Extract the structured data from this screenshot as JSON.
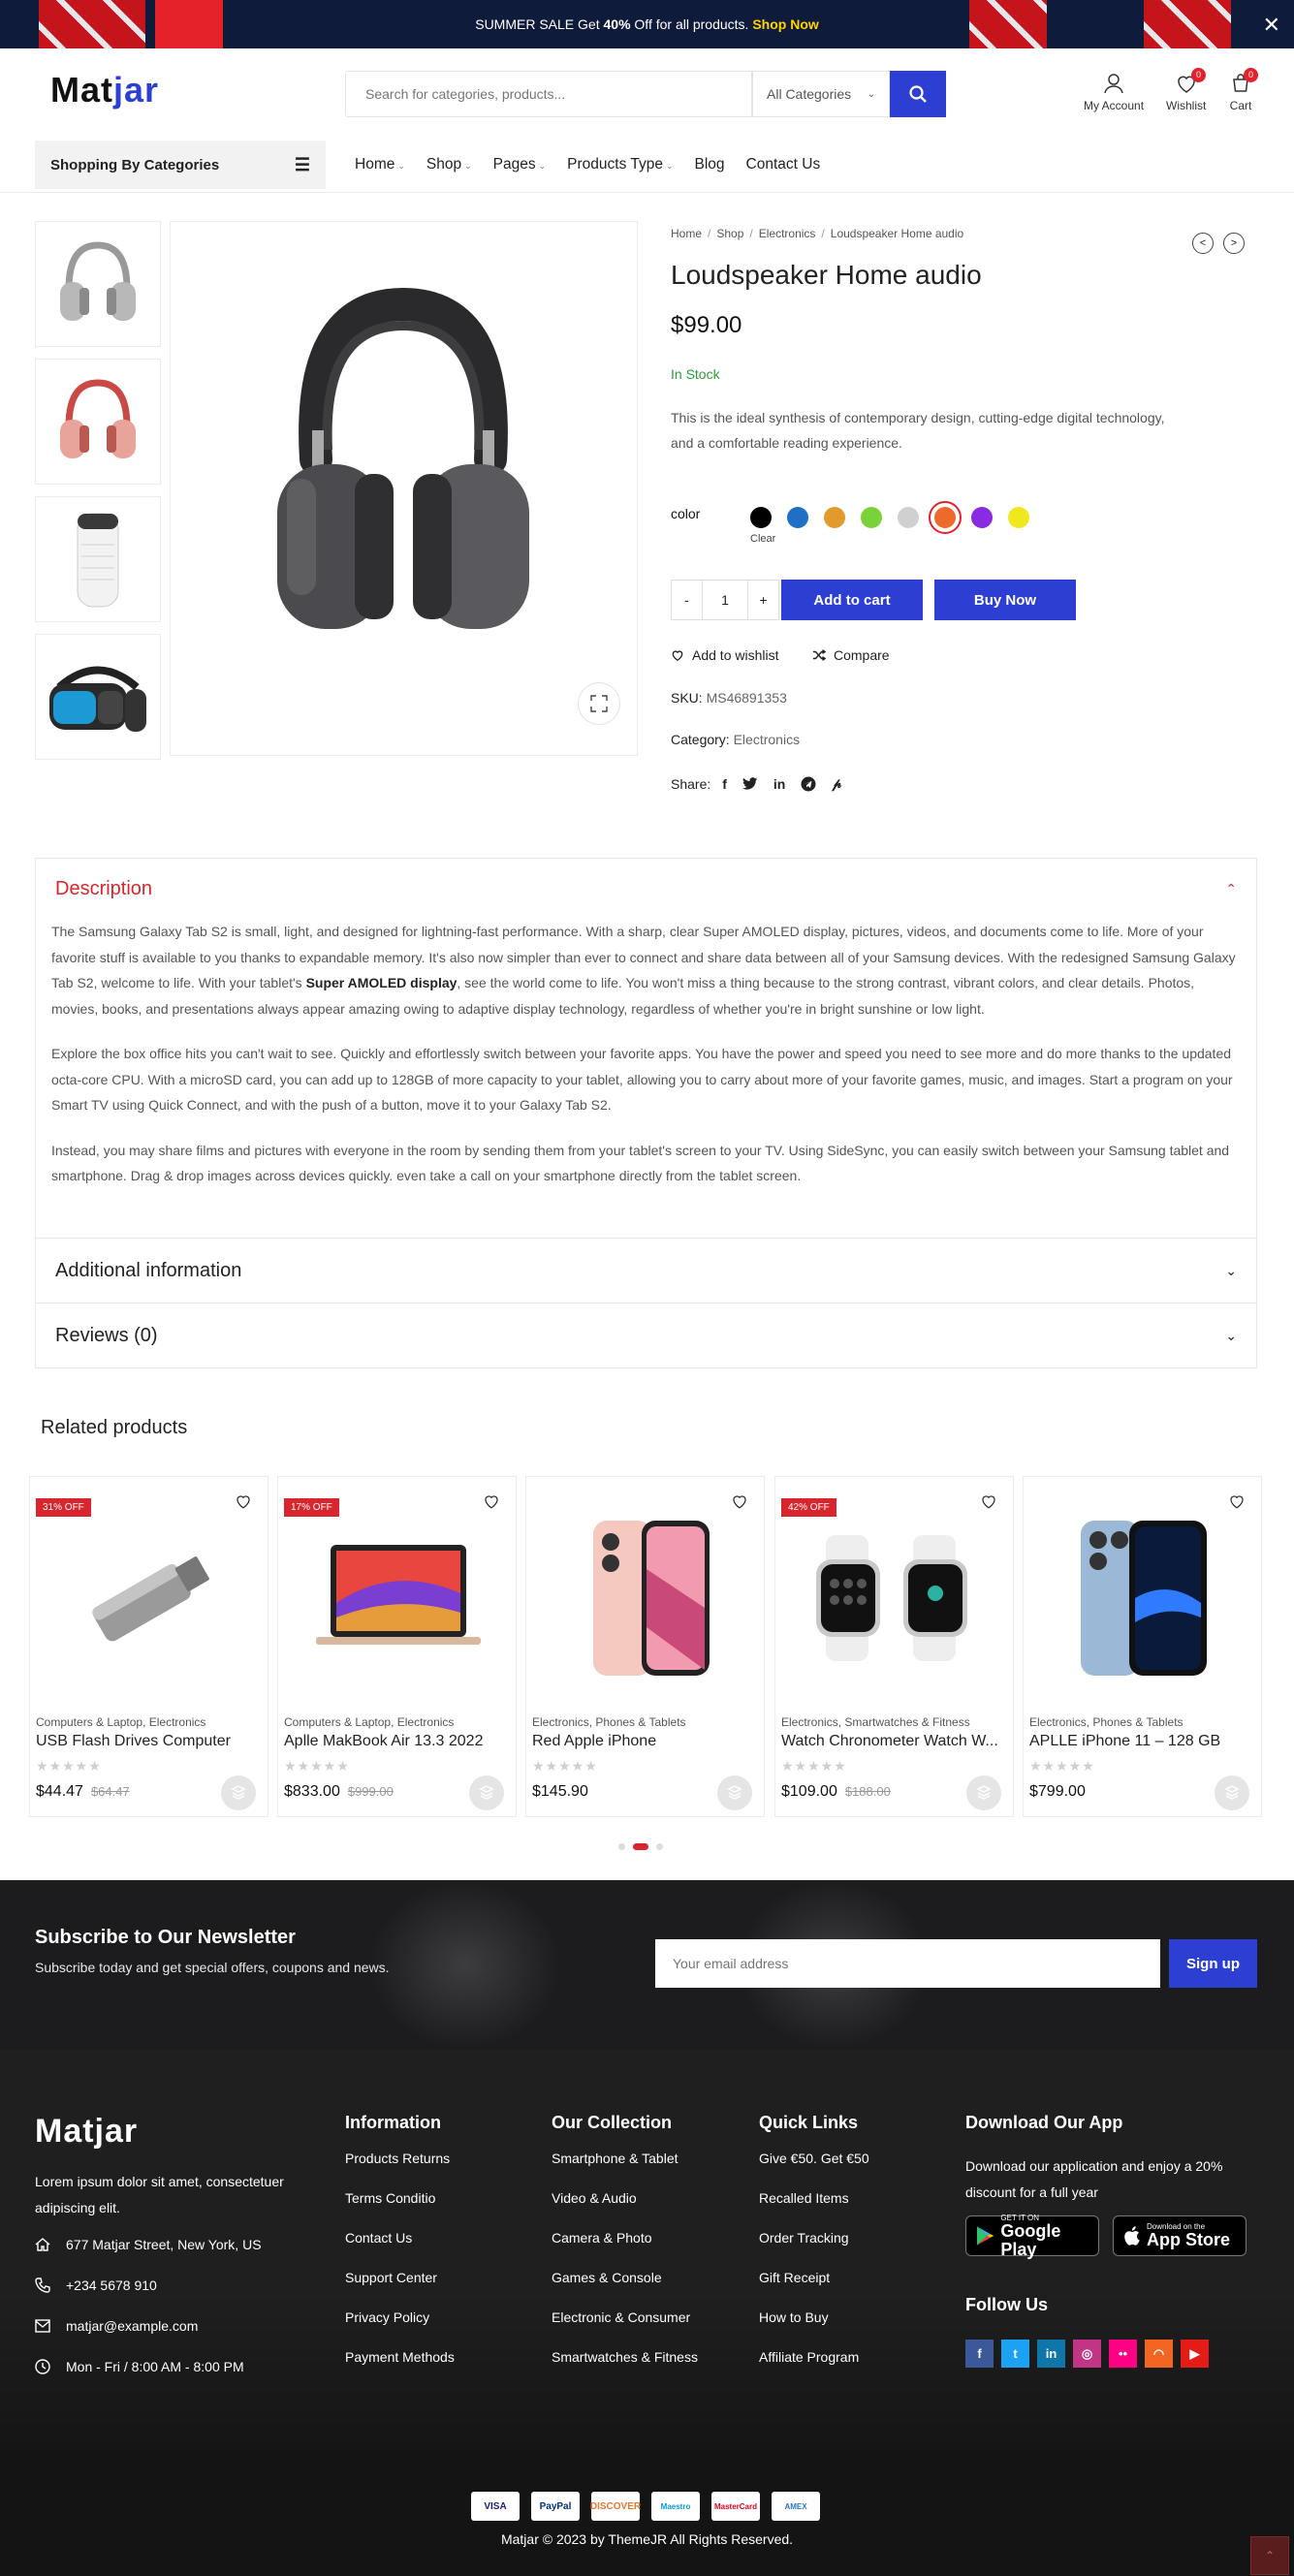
{
  "banner": {
    "text_before": "SUMMER SALE Get ",
    "percent": "40%",
    "text_after": " Off for all products. ",
    "cta": "Shop Now",
    "close": "✕"
  },
  "header": {
    "logo_main": "Mat",
    "logo_accent": "jar",
    "search_placeholder": "Search for categories, products...",
    "category_select": "All Categories",
    "account_label": "My Account",
    "wishlist_label": "Wishlist",
    "wishlist_count": "0",
    "cart_label": "Cart",
    "cart_count": "0"
  },
  "nav": {
    "categories_button": "Shopping By Categories",
    "items": [
      "Home",
      "Shop",
      "Pages",
      "Products Type",
      "Blog",
      "Contact Us"
    ]
  },
  "breadcrumb": [
    "Home",
    "Shop",
    "Electronics",
    "Loudspeaker Home audio"
  ],
  "product": {
    "title": "Loudspeaker Home audio",
    "price": "$99.00",
    "stock": "In Stock",
    "short_desc": "This is the ideal synthesis of contemporary design, cutting-edge digital technology, and a comfortable reading experience.",
    "color_label": "color",
    "clear_label": "Clear",
    "colors": [
      "#000000",
      "#1e6fc5",
      "#e39a2d",
      "#7ad23a",
      "#d0d0d0",
      "#ee6a2a",
      "#8a2be2",
      "#f0e81e"
    ],
    "selected_color": "#ee6a2a",
    "qty_minus": "-",
    "qty": "1",
    "qty_plus": "+",
    "add_to_cart": "Add to cart",
    "buy_now": "Buy Now",
    "wishlist": "Add to wishlist",
    "compare": "Compare",
    "sku_label": "SKU:",
    "sku": "MS46891353",
    "category_label": "Category:",
    "category": "Electronics",
    "share_label": "Share:"
  },
  "tabs": {
    "description_title": "Description",
    "description_paragraphs": [
      "The Samsung Galaxy Tab S2 is small, light, and designed for lightning-fast performance. With a sharp, clear Super AMOLED display, pictures, videos, and documents come to life. More of your favorite stuff is available to you thanks to expandable memory. It's also now simpler than ever to connect and share data between all of your Samsung devices. With the redesigned Samsung Galaxy Tab S2, welcome to life. With your tablet's ",
      "Super AMOLED display",
      ", see the world come to life. You won't miss a thing because to the strong contrast, vibrant colors, and clear details. Photos, movies, books, and presentations always appear amazing owing to adaptive display technology, regardless of whether you're in bright sunshine or low light.",
      "Explore the box office hits you can't wait to see. Quickly and effortlessly switch between your favorite apps. You have the power and speed you need to see more and do more thanks to the updated octa-core CPU. With a microSD card, you can add up to 128GB of more capacity to your tablet, allowing you to carry about more of your favorite games, music, and images. Start a program on your Smart TV using Quick Connect, and with the push of a button, move it to your Galaxy Tab S2.",
      "Instead, you may share films and pictures with everyone in the room by sending them from your tablet's screen to your TV. Using SideSync, you can easily switch between your Samsung tablet and smartphone. Drag & drop images across devices quickly. even take a call on your smartphone directly from the tablet screen."
    ],
    "additional_title": "Additional information",
    "reviews_title": "Reviews (0)"
  },
  "related": {
    "title": "Related products",
    "items": [
      {
        "badge": "31% OFF",
        "category": "Computers & Laptop, Electronics",
        "name": "USB Flash Drives Computer",
        "price": "$44.47",
        "old_price": "$64.47"
      },
      {
        "badge": "17% OFF",
        "category": "Computers & Laptop, Electronics",
        "name": "Aplle MakBook Air 13.3 2022",
        "price": "$833.00",
        "old_price": "$999.00"
      },
      {
        "badge": "",
        "category": "Electronics, Phones & Tablets",
        "name": "Red Apple iPhone",
        "price": "$145.90",
        "old_price": ""
      },
      {
        "badge": "42% OFF",
        "category": "Electronics, Smartwatches & Fitness",
        "name": "Watch Chronometer Watch W...",
        "price": "$109.00",
        "old_price": "$188.00"
      },
      {
        "badge": "",
        "category": "Electronics, Phones & Tablets",
        "name": "APLLE iPhone 11 – 128 GB",
        "price": "$799.00",
        "old_price": ""
      }
    ],
    "stars": "★★★★★"
  },
  "newsletter": {
    "title": "Subscribe to Our Newsletter",
    "subtitle": "Subscribe today and get special offers, coupons and news.",
    "placeholder": "Your email address",
    "button": "Sign up"
  },
  "footer": {
    "logo": "Matjar",
    "about": "Lorem ipsum dolor sit amet, consectetuer adipiscing elit.",
    "address": "677 Matjar Street, New York, US",
    "phone": "+234 5678 910",
    "email": "matjar@example.com",
    "hours": "Mon - Fri / 8:00 AM - 8:00 PM",
    "columns": [
      {
        "title": "Information",
        "links": [
          "Products Returns",
          "Terms Conditio",
          "Contact Us",
          "Support Center",
          "Privacy Policy",
          "Payment Methods"
        ]
      },
      {
        "title": "Our Collection",
        "links": [
          "Smartphone & Tablet",
          "Video & Audio",
          "Camera & Photo",
          "Games & Console",
          "Electronic & Consumer",
          "Smartwatches & Fitness"
        ]
      },
      {
        "title": "Quick Links",
        "links": [
          "Give €50. Get €50",
          "Recalled Items",
          "Order Tracking",
          "Gift Receipt",
          "How to Buy",
          "Affiliate Program"
        ]
      }
    ],
    "app_title": "Download Our App",
    "app_text": "Download our application and enjoy a 20% discount for a full year",
    "google_small": "GET IT ON",
    "google_big": "Google Play",
    "apple_small": "Download on the",
    "apple_big": "App Store",
    "follow_title": "Follow Us",
    "social": [
      {
        "icon": "facebook-icon",
        "glyph": "f",
        "color": "#3b5998"
      },
      {
        "icon": "twitter-icon",
        "glyph": "t",
        "color": "#1da1f2"
      },
      {
        "icon": "linkedin-icon",
        "glyph": "in",
        "color": "#0e76a8"
      },
      {
        "icon": "instagram-icon",
        "glyph": "◎",
        "color": "#c13584"
      },
      {
        "icon": "flickr-icon",
        "glyph": "••",
        "color": "#ff0084"
      },
      {
        "icon": "rss-icon",
        "glyph": "◠",
        "color": "#f26522"
      },
      {
        "icon": "youtube-icon",
        "glyph": "▶",
        "color": "#e41b17"
      }
    ],
    "payments": [
      "VISA",
      "PayPal",
      "DISCOVER",
      "Maestro",
      "MasterCard",
      "AMEX"
    ],
    "copyright": "Matjar © 2023 by  ThemeJR  All Rights Reserved."
  },
  "colors": {
    "accent": "#2d3fd3",
    "sale": "#d7262d",
    "stock": "#2e9b3a"
  }
}
